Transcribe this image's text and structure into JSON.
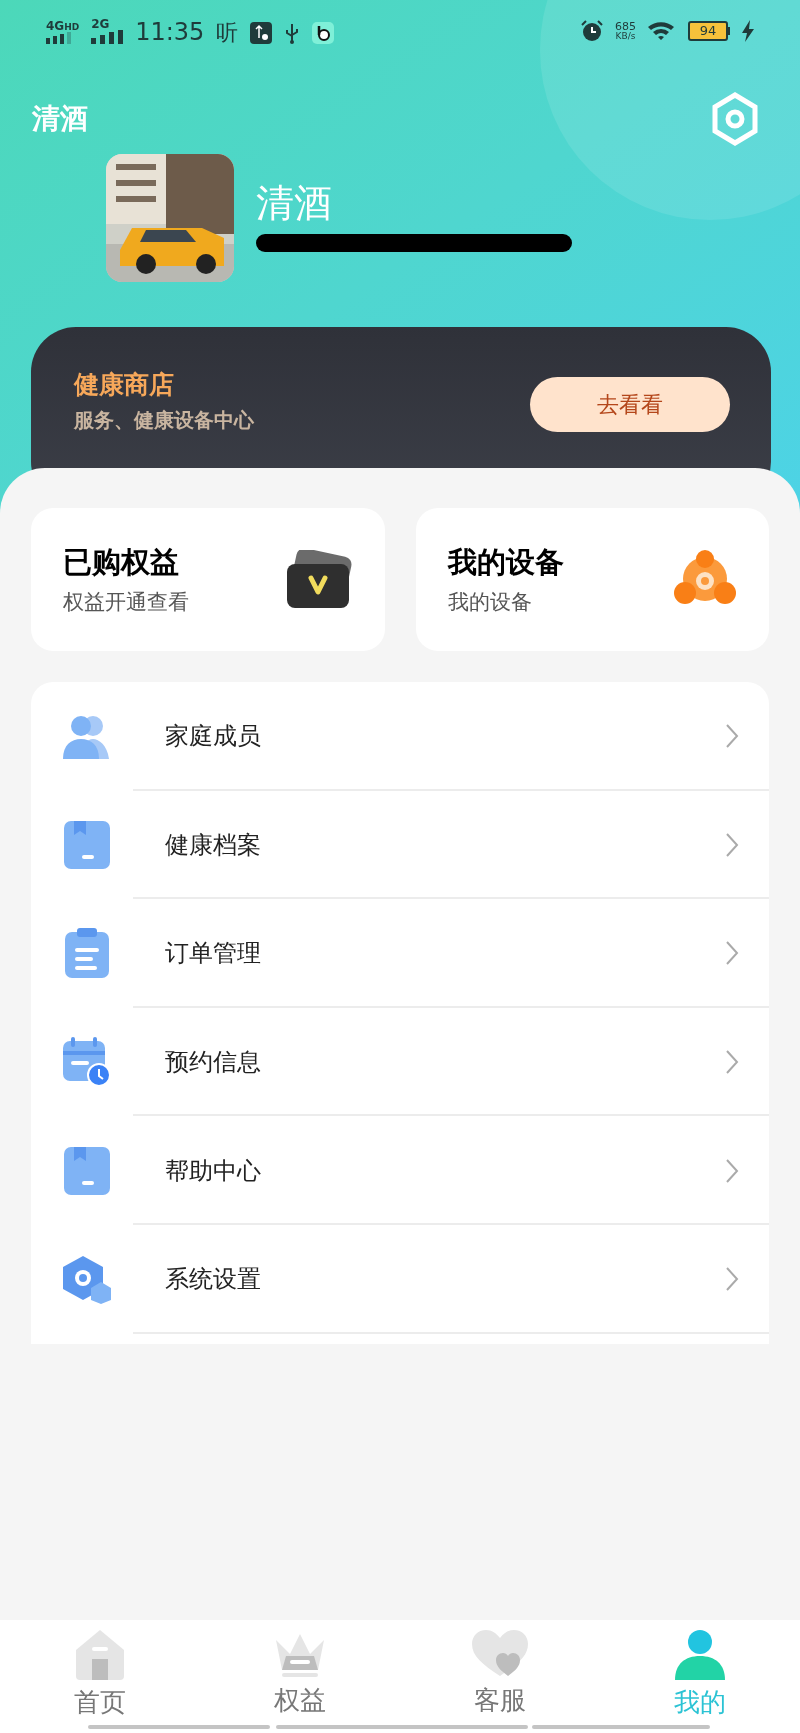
{
  "status_bar": {
    "network_1": "4G",
    "network_1_badge": "HD",
    "network_2": "2G",
    "time": "11:35",
    "listen_glyph": "听",
    "speed": "685",
    "speed_unit": "KB/s",
    "battery": "94"
  },
  "header": {
    "title": "清酒",
    "user_name": "清酒"
  },
  "store_banner": {
    "title": "健康商店",
    "subtitle": "服务、健康设备中心",
    "button": "去看看"
  },
  "quick_cards": [
    {
      "kind": "benefits",
      "title": "已购权益",
      "subtitle": "权益开通查看"
    },
    {
      "kind": "device",
      "title": "我的设备",
      "subtitle": "我的设备"
    }
  ],
  "menu": [
    {
      "kind": "members",
      "label": "家庭成员"
    },
    {
      "kind": "folder",
      "label": "健康档案"
    },
    {
      "kind": "clipboard",
      "label": "订单管理"
    },
    {
      "kind": "calendar",
      "label": "预约信息"
    },
    {
      "kind": "folder",
      "label": "帮助中心"
    },
    {
      "kind": "hexagon",
      "label": "系统设置"
    }
  ],
  "tab_bar": [
    {
      "kind": "home",
      "label": "首页",
      "selected": false
    },
    {
      "kind": "crown",
      "label": "权益",
      "selected": false
    },
    {
      "kind": "hearts",
      "label": "客服",
      "selected": false
    },
    {
      "kind": "person",
      "label": "我的",
      "selected": true
    }
  ]
}
